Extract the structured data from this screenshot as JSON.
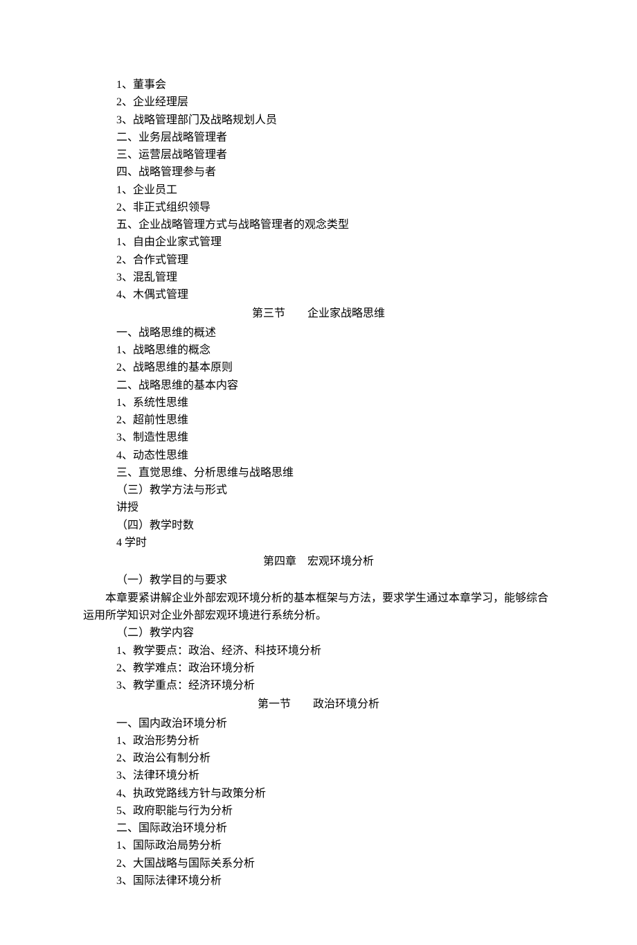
{
  "block1": {
    "lines": [
      "1、董事会",
      "2、企业经理层",
      "3、战略管理部门及战略规划人员",
      "二、业务层战略管理者",
      "三、运营层战略管理者",
      "四、战略管理参与者",
      "1、企业员工",
      "2、非正式组织领导",
      "五、企业战略管理方式与战略管理者的观念类型",
      "1、自由企业家式管理",
      "2、合作式管理",
      "3、混乱管理",
      "4、木偶式管理"
    ]
  },
  "section3": {
    "title": "第三节　　企业家战略思维",
    "lines": [
      "一、战略思维的概述",
      "1、战略思维的概念",
      "2、战略思维的基本原则",
      "二、战略思维的基本内容",
      "1、系统性思维",
      "2、超前性思维",
      "3、制造性思维",
      "4、动态性思维",
      "三、直觉思维、分析思维与战略思维",
      "（三）教学方法与形式",
      "讲授",
      "（四）教学时数",
      "4 学时"
    ]
  },
  "chapter4": {
    "title": "第四章　宏观环境分析",
    "purpose_label": "（一）教学目的与要求",
    "purpose_text": "本章要紧讲解企业外部宏观环境分析的基本框架与方法，要求学生通过本章学习，能够综合运用所学知识对企业外部宏观环境进行系统分析。",
    "content_label": "（二）教学内容",
    "points": [
      "1、教学要点：政治、经济、科技环境分析",
      "2、教学难点：政治环境分析",
      "3、教学重点：经济环境分析"
    ]
  },
  "section4_1": {
    "title": "第一节　　政治环境分析",
    "lines": [
      "一、国内政治环境分析",
      "1、政治形势分析",
      "2、政治公有制分析",
      "3、法律环境分析",
      "4、执政党路线方针与政策分析",
      "5、政府职能与行为分析",
      "二、国际政治环境分析",
      "1、国际政治局势分析",
      "2、大国战略与国际关系分析",
      "3、国际法律环境分析"
    ]
  }
}
